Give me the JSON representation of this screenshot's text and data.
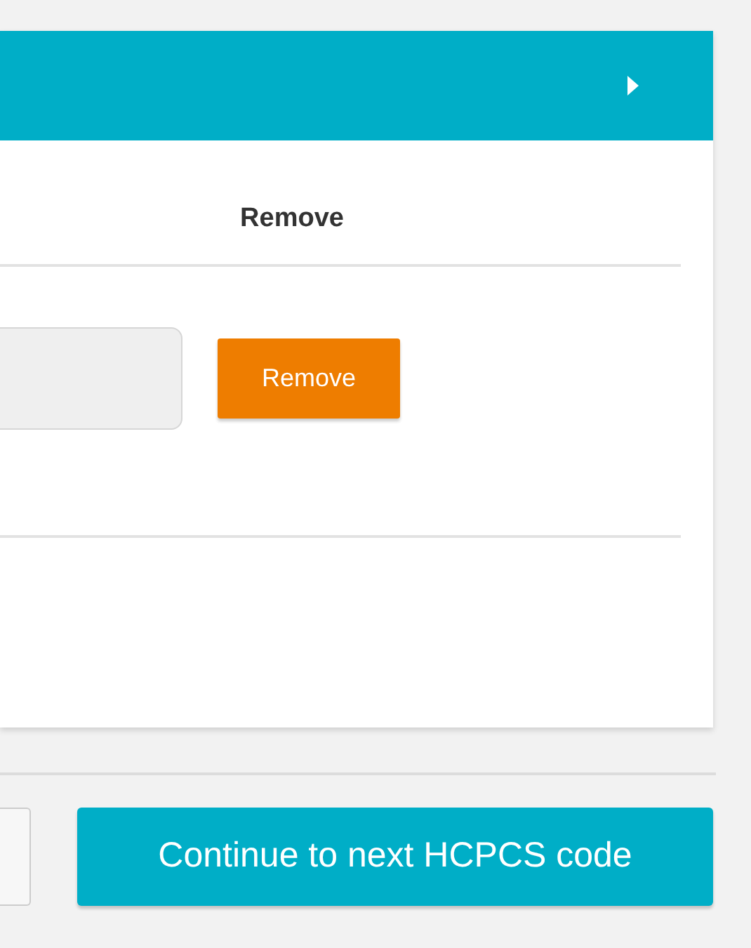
{
  "panel": {
    "columns": [
      "Remove"
    ],
    "rows": [
      {
        "action": "Remove"
      }
    ]
  },
  "footer": {
    "continue_button": "Continue to next HCPCS code"
  }
}
